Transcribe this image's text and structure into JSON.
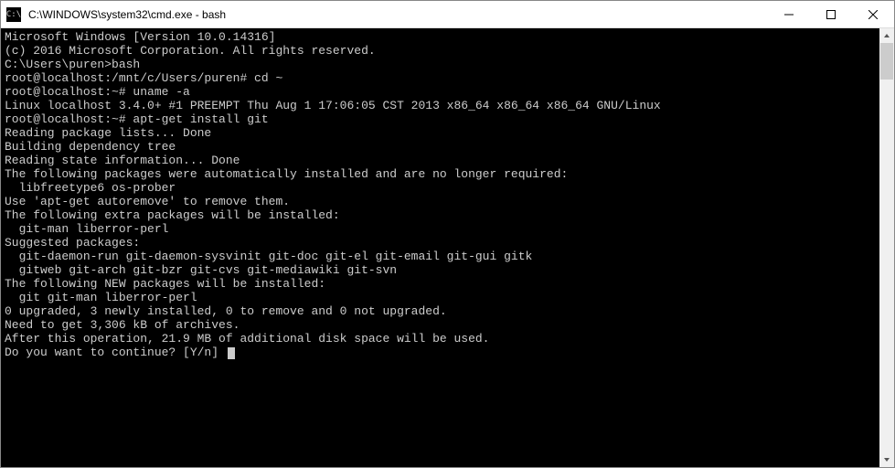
{
  "titlebar": {
    "icon_label": "C:\\",
    "title": "C:\\WINDOWS\\system32\\cmd.exe - bash"
  },
  "terminal": {
    "lines": [
      "Microsoft Windows [Version 10.0.14316]",
      "(c) 2016 Microsoft Corporation. All rights reserved.",
      "",
      "C:\\Users\\puren>bash",
      "root@localhost:/mnt/c/Users/puren# cd ~",
      "root@localhost:~# uname -a",
      "Linux localhost 3.4.0+ #1 PREEMPT Thu Aug 1 17:06:05 CST 2013 x86_64 x86_64 x86_64 GNU/Linux",
      "root@localhost:~# apt-get install git",
      "Reading package lists... Done",
      "Building dependency tree",
      "Reading state information... Done",
      "The following packages were automatically installed and are no longer required:",
      "  libfreetype6 os-prober",
      "Use 'apt-get autoremove' to remove them.",
      "The following extra packages will be installed:",
      "  git-man liberror-perl",
      "Suggested packages:",
      "  git-daemon-run git-daemon-sysvinit git-doc git-el git-email git-gui gitk",
      "  gitweb git-arch git-bzr git-cvs git-mediawiki git-svn",
      "The following NEW packages will be installed:",
      "  git git-man liberror-perl",
      "0 upgraded, 3 newly installed, 0 to remove and 0 not upgraded.",
      "Need to get 3,306 kB of archives.",
      "After this operation, 21.9 MB of additional disk space will be used.",
      "Do you want to continue? [Y/n] "
    ]
  }
}
